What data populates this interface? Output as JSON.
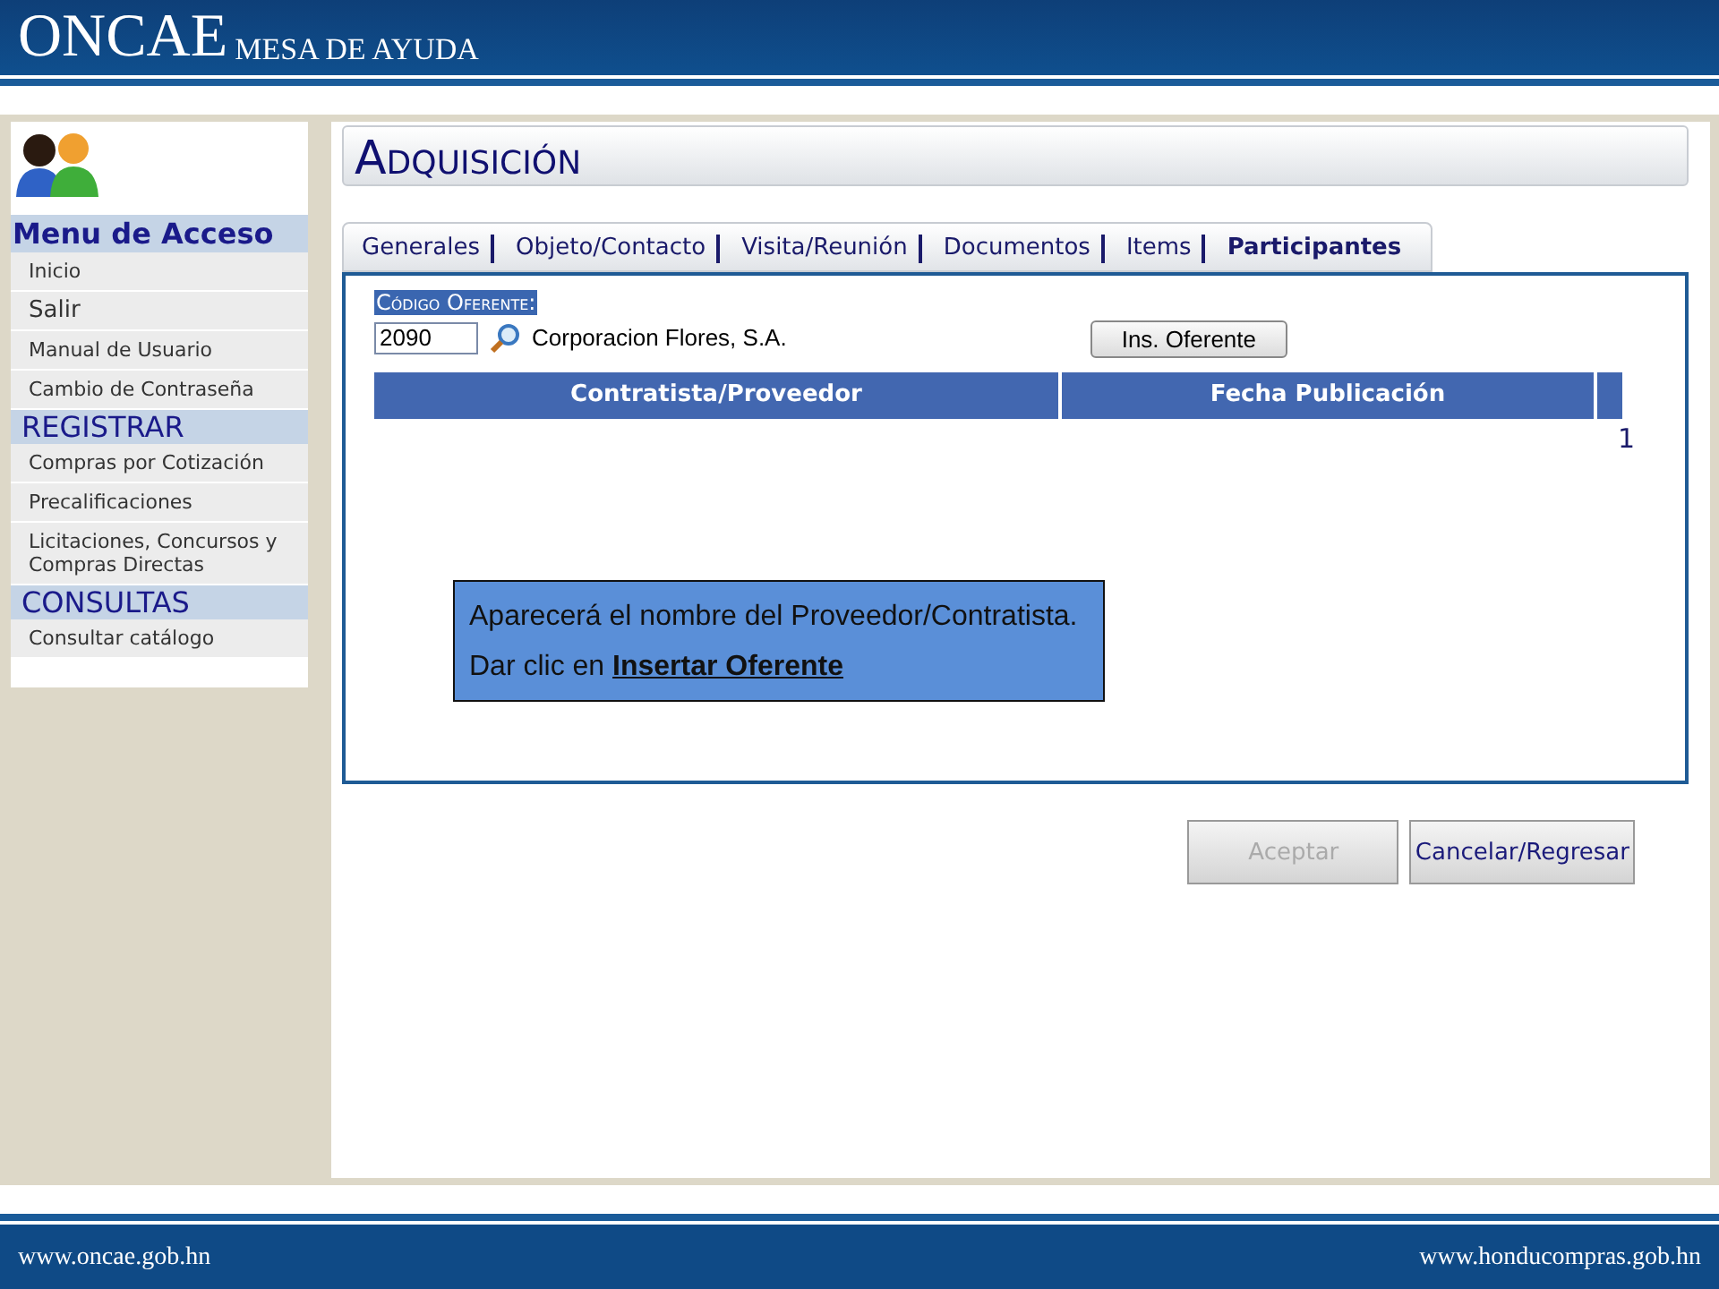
{
  "header": {
    "logo": "ONCAE",
    "subtitle": "MESA DE AYUDA"
  },
  "sidebar": {
    "sections": [
      {
        "title": "Menu de Acceso",
        "kind": "main",
        "items": [
          {
            "label": "Inicio",
            "kind": "small"
          },
          {
            "label": "Salir",
            "kind": "large"
          },
          {
            "label": "Manual de Usuario",
            "kind": "small"
          },
          {
            "label": "Cambio de Contraseña",
            "kind": "small"
          }
        ]
      },
      {
        "title": "REGISTRAR",
        "kind": "group",
        "items": [
          {
            "label": "Compras por Cotización",
            "kind": "small"
          },
          {
            "label": "Precalificaciones",
            "kind": "small"
          },
          {
            "label": "Licitaciones, Concursos y Compras Directas",
            "kind": "small"
          }
        ]
      },
      {
        "title": "CONSULTAS",
        "kind": "group",
        "items": [
          {
            "label": "Consultar catálogo",
            "kind": "small"
          }
        ]
      }
    ]
  },
  "page_title": "Adquisición",
  "tabs": [
    {
      "label": "Generales",
      "selected": false
    },
    {
      "label": "Objeto/Contacto",
      "selected": false
    },
    {
      "label": "Visita/Reunión",
      "selected": false
    },
    {
      "label": "Documentos",
      "selected": false
    },
    {
      "label": "Items",
      "selected": false
    },
    {
      "label": "Participantes",
      "selected": true
    }
  ],
  "form": {
    "label": "Código Oferente:",
    "value": "2090",
    "name": "Corporacion Flores, S.A.",
    "button": "Ins. Oferente"
  },
  "table": {
    "columns": [
      "Contratista/Proveedor",
      "Fecha Publicación"
    ],
    "pager": "1"
  },
  "callout": "Aparecerá el nombre del Proveedor/Contratista. Dar clic en **Insertar Oferente**",
  "buttons": [
    {
      "label": "Aceptar",
      "disabled": true
    },
    {
      "label": "Cancelar/Regresar",
      "disabled": false
    }
  ],
  "footer": {
    "left": "www.oncae.gob.hn",
    "right": "www.honducompras.gob.hn"
  }
}
